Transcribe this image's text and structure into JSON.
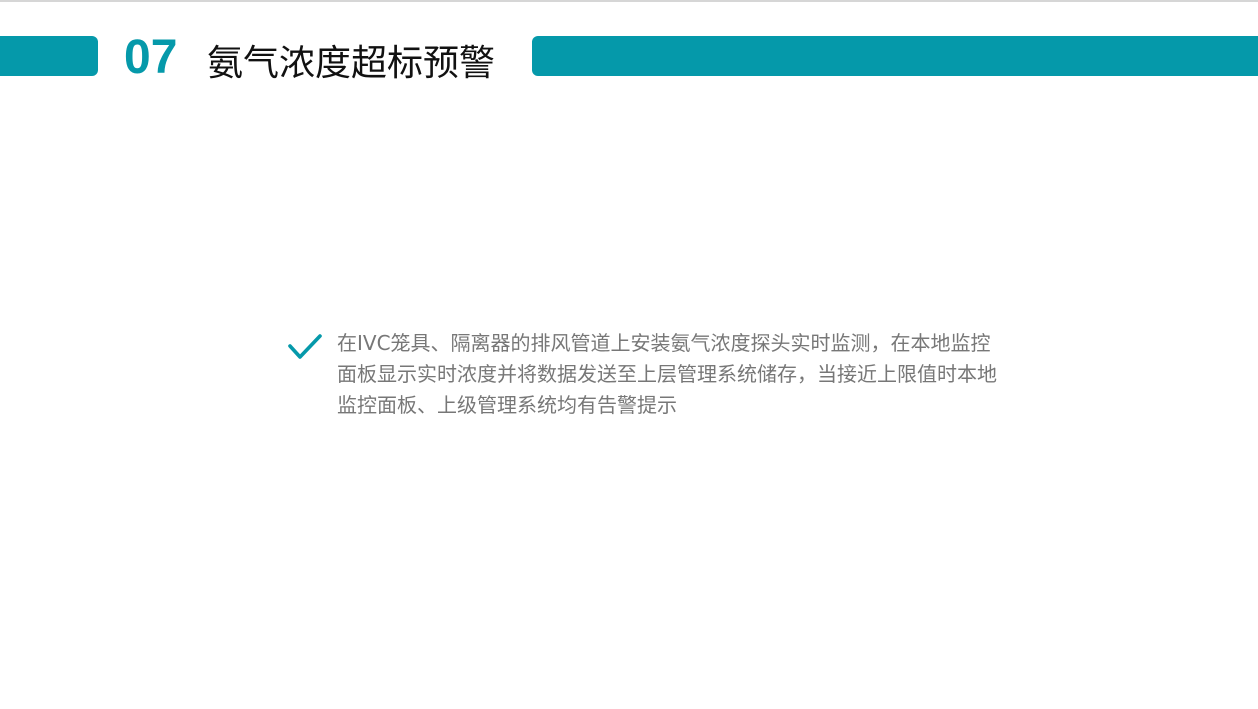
{
  "header": {
    "number": "07",
    "title": "氨气浓度超标预警"
  },
  "content": {
    "bullet_icon": "check-icon",
    "bullet_text": "在IVC笼具、隔离器的排风管道上安装氨气浓度探头实时监测，在本地监控面板显示实时浓度并将数据发送至上层管理系统储存，当接近上限值时本地监控面板、上级管理系统均有告警提示"
  },
  "colors": {
    "accent": "#0599aa",
    "title": "#111111",
    "body_text": "#777777"
  }
}
